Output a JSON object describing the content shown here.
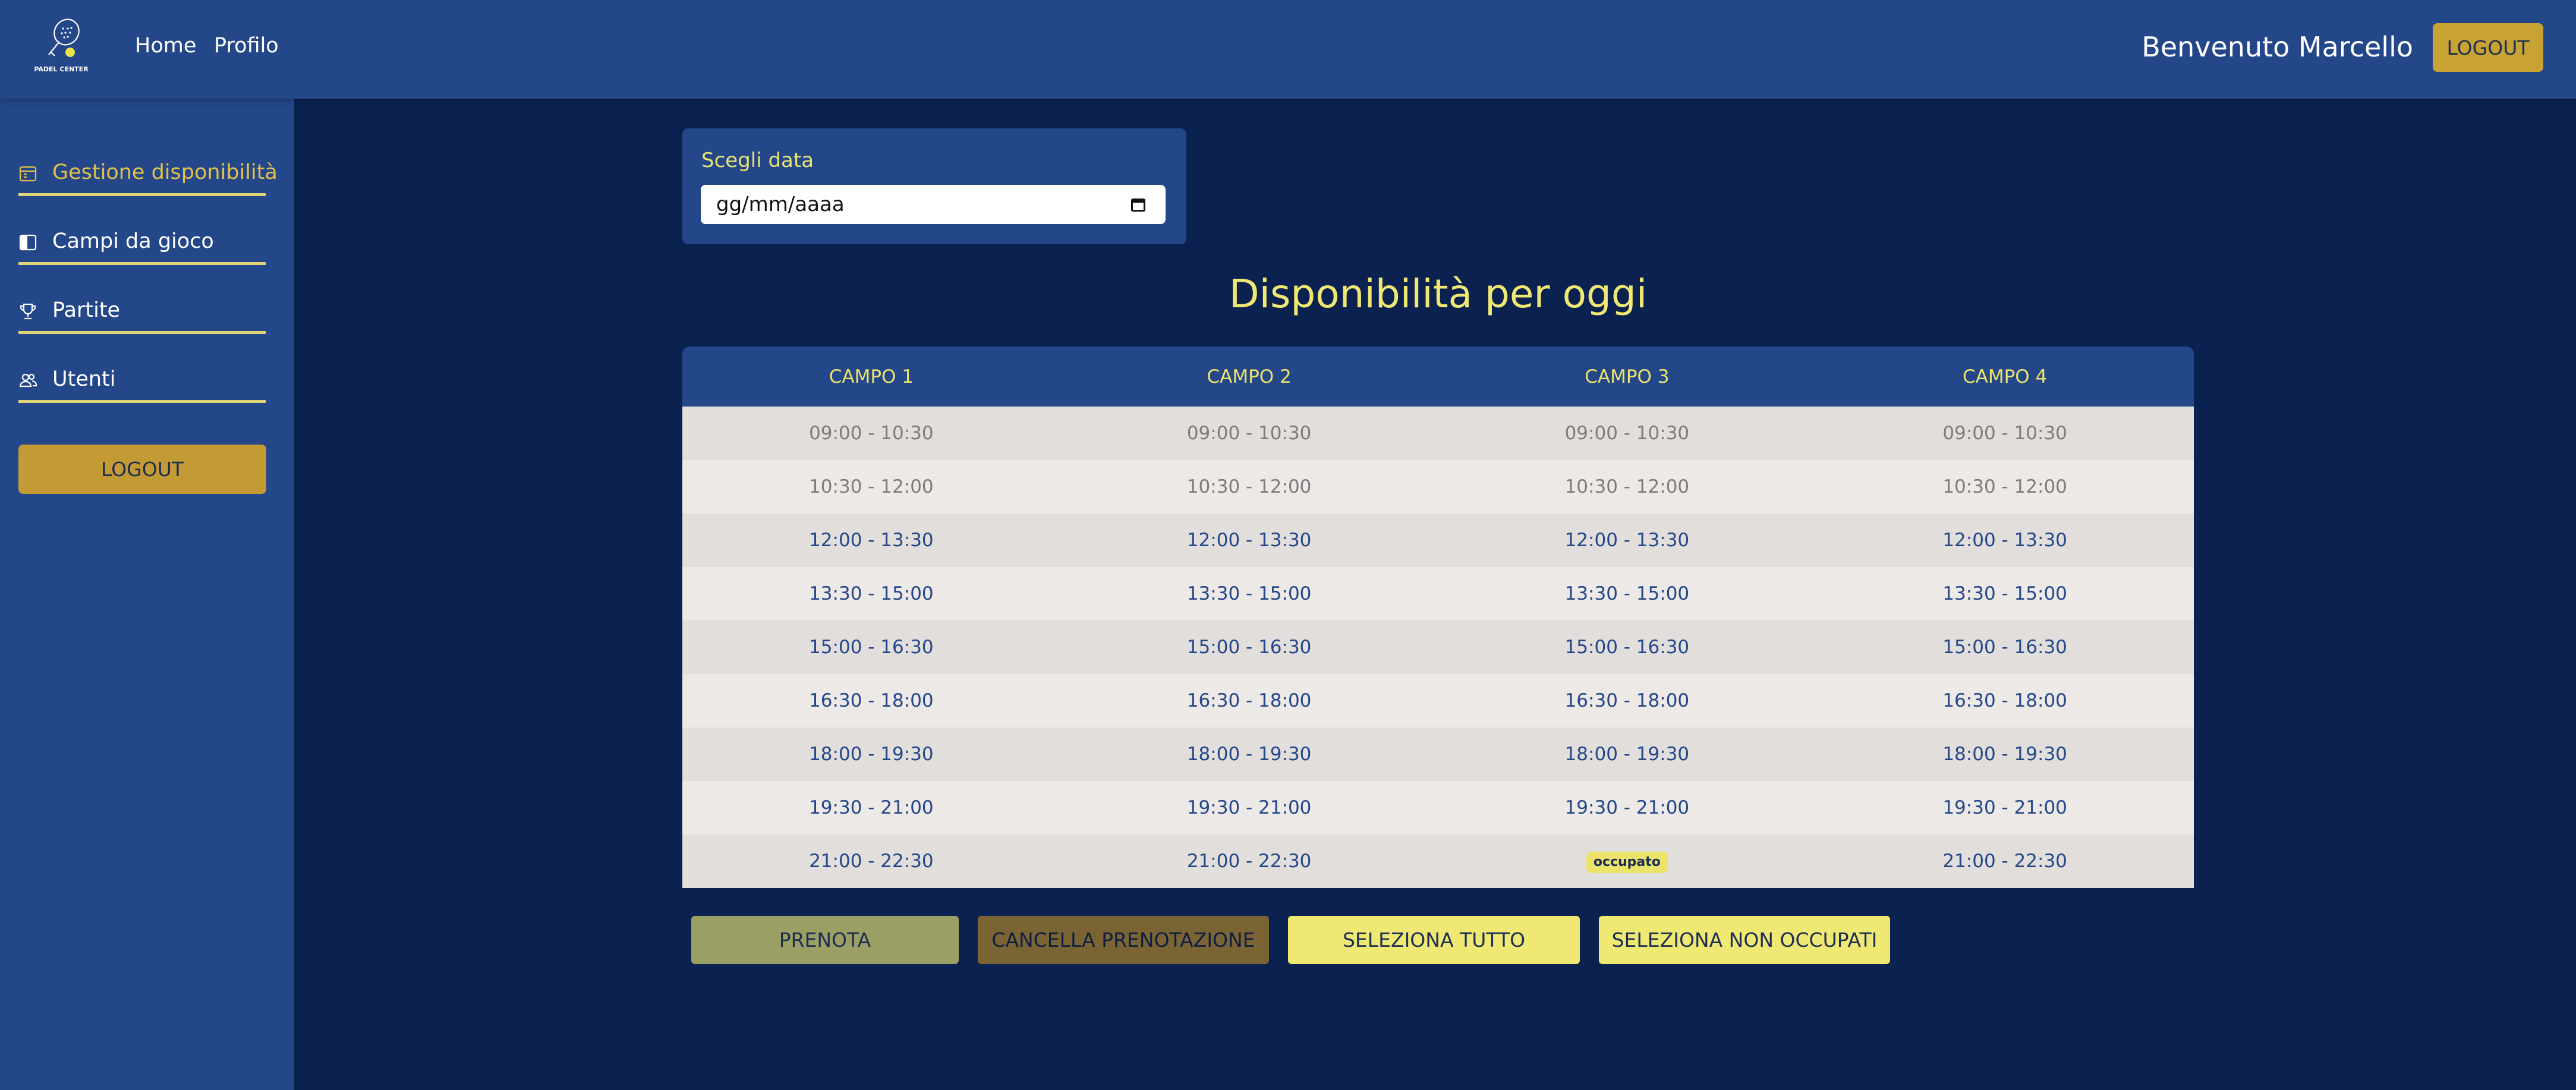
{
  "header": {
    "logo_text": "PADEL CENTER",
    "nav": [
      {
        "label": "Home"
      },
      {
        "label": "Profilo"
      }
    ],
    "welcome": "Benvenuto Marcello",
    "logout_label": "LOGOUT"
  },
  "sidebar": {
    "items": [
      {
        "label": "Gestione disponibilità",
        "icon": "calendar-icon",
        "active": true
      },
      {
        "label": "Campi da gioco",
        "icon": "court-icon",
        "active": false
      },
      {
        "label": "Partite",
        "icon": "trophy-icon",
        "active": false
      },
      {
        "label": "Utenti",
        "icon": "users-icon",
        "active": false
      }
    ],
    "logout_label": "LOGOUT"
  },
  "date_picker": {
    "label": "Scegli data",
    "placeholder": "gg/mm/aaaa"
  },
  "title": "Disponibilità per oggi",
  "table": {
    "columns": [
      "CAMPO 1",
      "CAMPO 2",
      "CAMPO 3",
      "CAMPO 4"
    ],
    "rows": [
      {
        "state": "past",
        "cells": [
          "09:00 - 10:30",
          "09:00 - 10:30",
          "09:00 - 10:30",
          "09:00 - 10:30"
        ]
      },
      {
        "state": "past",
        "cells": [
          "10:30 - 12:00",
          "10:30 - 12:00",
          "10:30 - 12:00",
          "10:30 - 12:00"
        ]
      },
      {
        "state": "future",
        "cells": [
          "12:00 - 13:30",
          "12:00 - 13:30",
          "12:00 - 13:30",
          "12:00 - 13:30"
        ]
      },
      {
        "state": "future",
        "cells": [
          "13:30 - 15:00",
          "13:30 - 15:00",
          "13:30 - 15:00",
          "13:30 - 15:00"
        ]
      },
      {
        "state": "future",
        "cells": [
          "15:00 - 16:30",
          "15:00 - 16:30",
          "15:00 - 16:30",
          "15:00 - 16:30"
        ]
      },
      {
        "state": "future",
        "cells": [
          "16:30 - 18:00",
          "16:30 - 18:00",
          "16:30 - 18:00",
          "16:30 - 18:00"
        ]
      },
      {
        "state": "future",
        "cells": [
          "18:00 - 19:30",
          "18:00 - 19:30",
          "18:00 - 19:30",
          "18:00 - 19:30"
        ]
      },
      {
        "state": "future",
        "cells": [
          "19:30 - 21:00",
          "19:30 - 21:00",
          "19:30 - 21:00",
          "19:30 - 21:00"
        ]
      },
      {
        "state": "future",
        "cells": [
          "21:00 - 22:30",
          "21:00 - 22:30",
          "occupato",
          "21:00 - 22:30"
        ]
      }
    ],
    "occupied_label": "occupato"
  },
  "actions": {
    "prenota": "PRENOTA",
    "cancella": "CANCELLA PRENOTAZIONE",
    "seleziona_tutto": "SELEZIONA TUTTO",
    "seleziona_non_occupati": "SELEZIONA NON OCCUPATI"
  },
  "colors": {
    "background": "#0b2150",
    "panel": "#24478a",
    "accent_yellow": "#efe873",
    "gold": "#c8a233"
  }
}
